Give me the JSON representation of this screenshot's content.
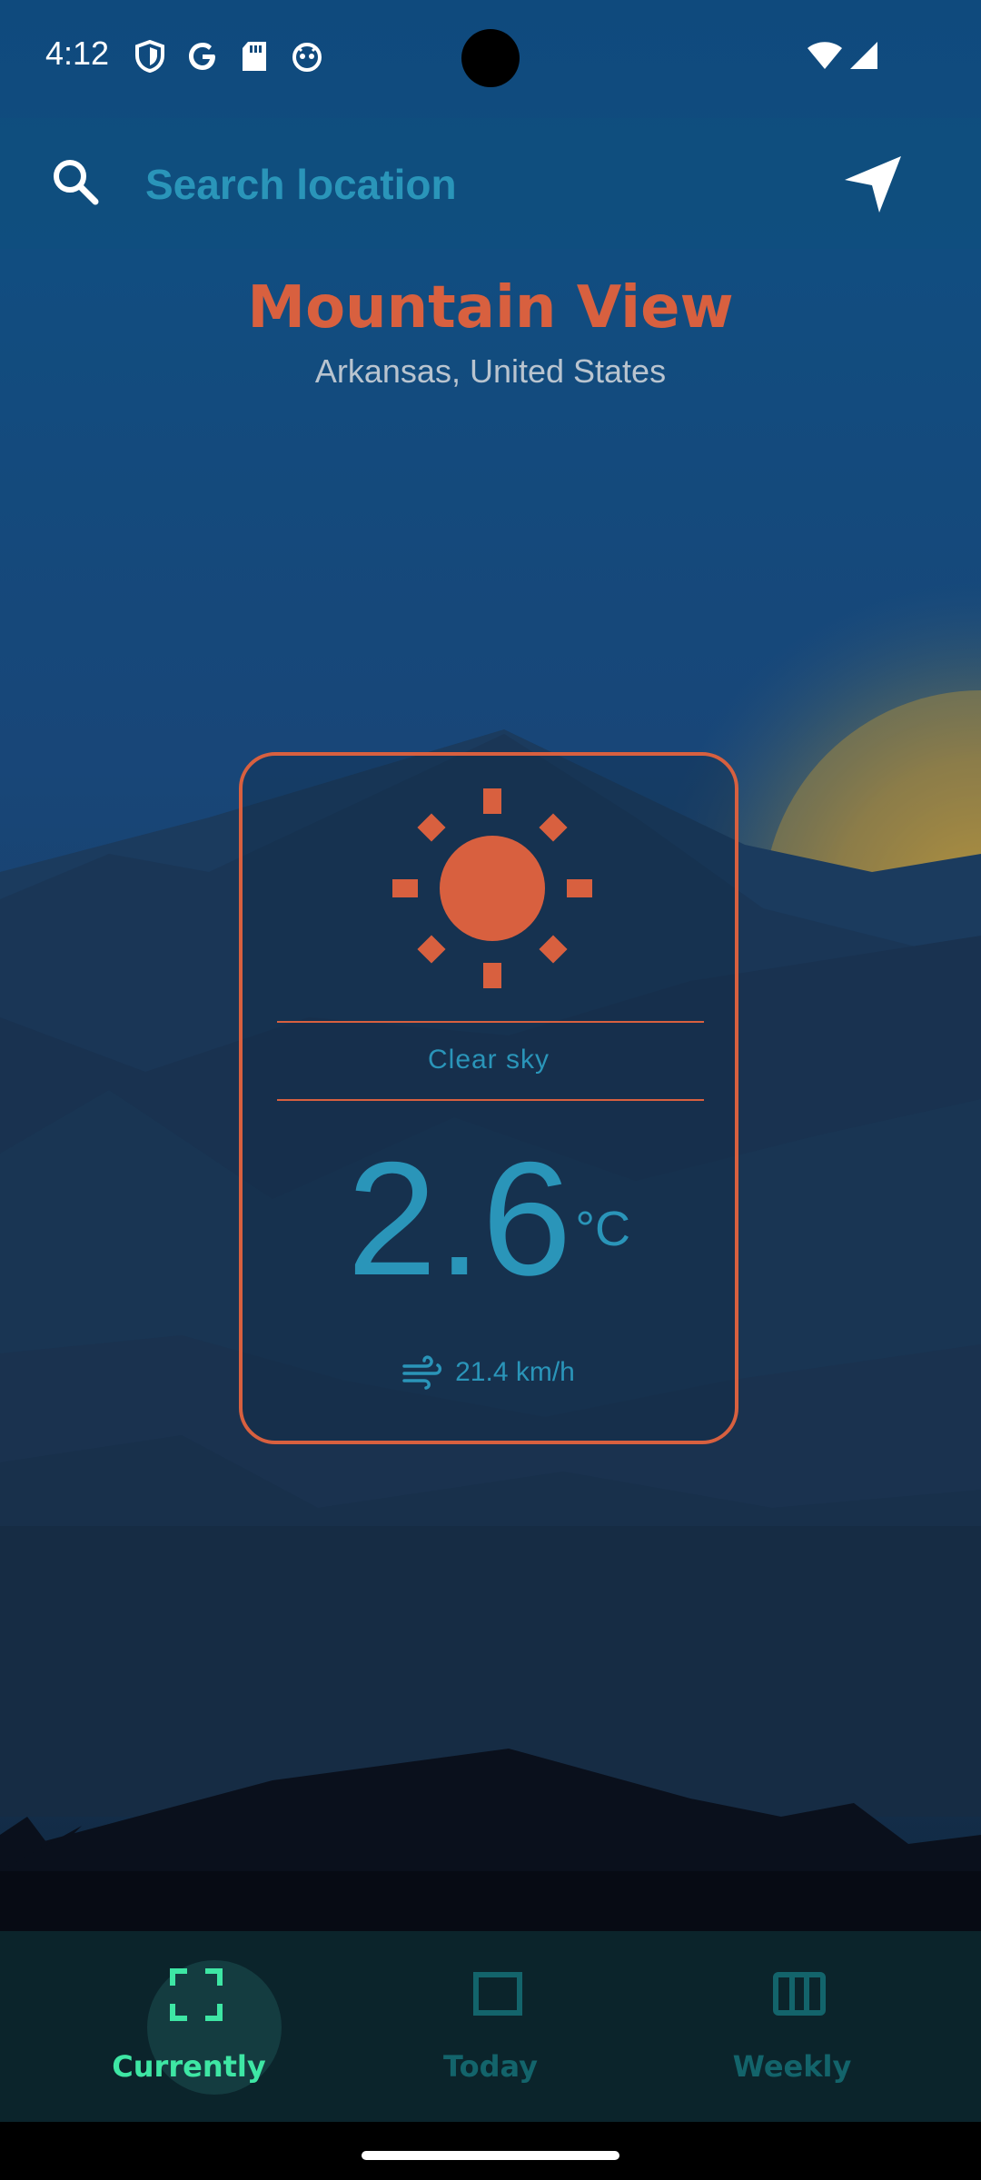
{
  "status_bar": {
    "time": "4:12",
    "icons": [
      "shield-icon",
      "google-icon",
      "sd-card-icon",
      "robot-face-icon",
      "wifi-icon",
      "signal-icon"
    ]
  },
  "search": {
    "placeholder": "Search location",
    "search_icon": "search-icon",
    "location_icon": "navigation-arrow-icon"
  },
  "location": {
    "city": "Mountain View",
    "region": "Arkansas, United States"
  },
  "weather": {
    "condition": "Clear sky",
    "condition_icon": "sun-icon",
    "temperature": "2.6",
    "unit": "°C",
    "wind": "21.4 km/h",
    "wind_icon": "wind-icon"
  },
  "bottom_nav": {
    "items": [
      {
        "label": "Currently",
        "icon": "fullscreen-icon",
        "active": true
      },
      {
        "label": "Today",
        "icon": "square-icon",
        "active": false
      },
      {
        "label": "Weekly",
        "icon": "columns-icon",
        "active": false
      }
    ]
  },
  "colors": {
    "accent_orange": "#d8603f",
    "accent_blue": "#2a95b9",
    "active_green": "#3ee6a4",
    "inactive_teal": "#13646b"
  }
}
